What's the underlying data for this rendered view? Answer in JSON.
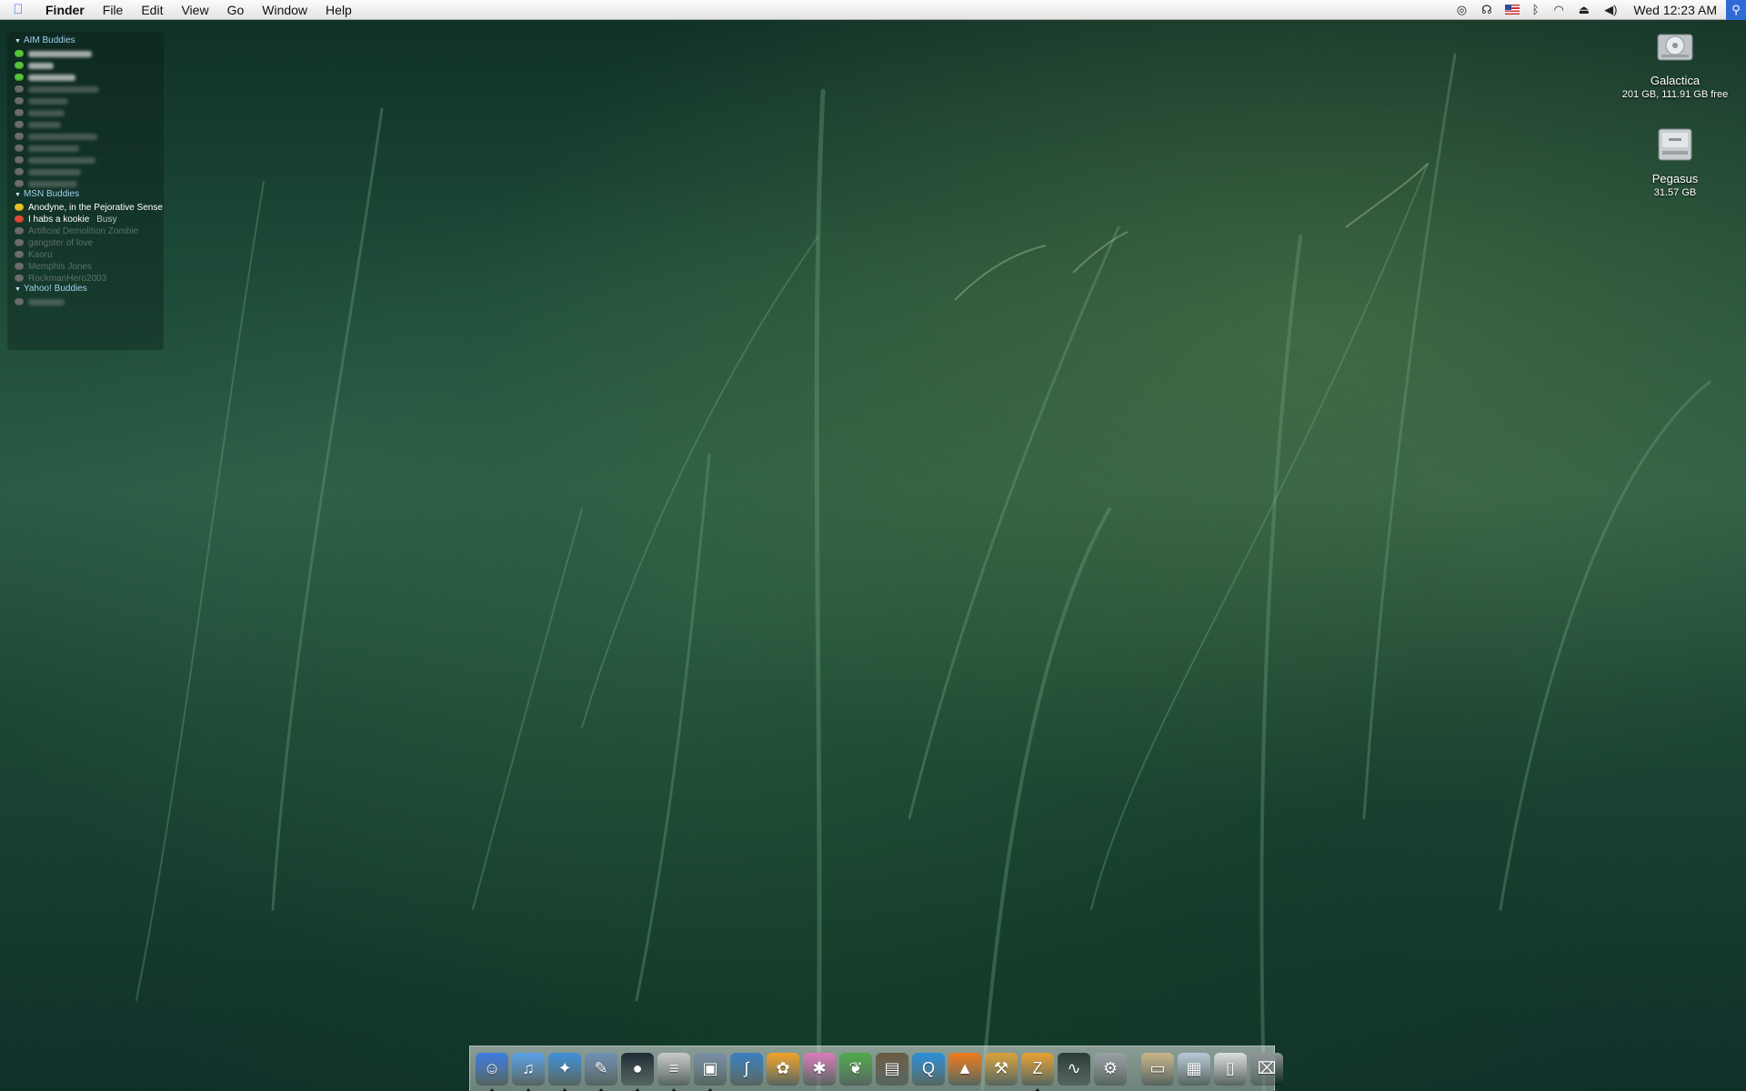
{
  "menubar": {
    "app_name": "Finder",
    "menus": [
      "File",
      "Edit",
      "View",
      "Go",
      "Window",
      "Help"
    ],
    "clock": "Wed 12:23 AM"
  },
  "buddy_list": {
    "groups": [
      {
        "name": "AIM Buddies"
      },
      {
        "name": "MSN Buddies"
      },
      {
        "name": "Yahoo! Buddies"
      }
    ],
    "msn_buddies": [
      {
        "name": "Anodyne, in the Pejorative Sense",
        "state": "available"
      },
      {
        "name": "I habs a kookie",
        "state": "busy",
        "status": "Busy"
      },
      {
        "name": "Artificial Demolition Zombie",
        "state": "offline"
      },
      {
        "name": "gangster of love",
        "state": "offline"
      },
      {
        "name": "Kaoru",
        "state": "offline"
      },
      {
        "name": "Memphis Jones",
        "state": "offline"
      },
      {
        "name": "RockmanHero2003",
        "state": "offline"
      }
    ]
  },
  "desktop_icons": [
    {
      "name": "Galactica",
      "info": "201 GB, 111.91 GB free"
    },
    {
      "name": "Pegasus",
      "info": "31.57 GB"
    }
  ],
  "colors": {
    "accent_blue": "#2f6bd6",
    "status_available": "#55c43a",
    "status_away": "#e8c02a",
    "status_busy": "#e04a3a"
  },
  "dock": {
    "apps": [
      {
        "icon": "finder-icon",
        "color": "#3b7be0",
        "glyph": "☺"
      },
      {
        "icon": "itunes-icon",
        "color": "#5aa0e8",
        "glyph": "♫"
      },
      {
        "icon": "safari-icon",
        "color": "#3d8fd8",
        "glyph": "✦"
      },
      {
        "icon": "preview-icon",
        "color": "#6f8fb3",
        "glyph": "✎"
      },
      {
        "icon": "chat-icon",
        "color": "#1f2a36",
        "glyph": "●"
      },
      {
        "icon": "textedit-icon",
        "color": "#c9c9c9",
        "glyph": "≡"
      },
      {
        "icon": "image-capture-icon",
        "color": "#7a8fa8",
        "glyph": "▣"
      },
      {
        "icon": "feather-icon",
        "color": "#3a7fc0",
        "glyph": "∫"
      },
      {
        "icon": "flower-icon",
        "color": "#f2a22a",
        "glyph": "✿"
      },
      {
        "icon": "pinwheel-icon",
        "color": "#d97ab8",
        "glyph": "✱"
      },
      {
        "icon": "leaf-icon",
        "color": "#4ea84a",
        "glyph": "❦"
      },
      {
        "icon": "photo-icon",
        "color": "#6a5a44",
        "glyph": "▤"
      },
      {
        "icon": "quicktime-icon",
        "color": "#2a8fd8",
        "glyph": "Q"
      },
      {
        "icon": "vlc-icon",
        "color": "#f07a1a",
        "glyph": "▲"
      },
      {
        "icon": "toolbox-icon",
        "color": "#d9a13a",
        "glyph": "⚒"
      },
      {
        "icon": "z-icon",
        "color": "#e8a030",
        "glyph": "Z"
      },
      {
        "icon": "activity-monitor-icon",
        "color": "#2a3a34",
        "glyph": "∿"
      },
      {
        "icon": "system-prefs-icon",
        "color": "#9aa0a6",
        "glyph": "⚙"
      }
    ],
    "docs": [
      {
        "icon": "folder-icon",
        "color": "#c9b488",
        "glyph": "▭"
      },
      {
        "icon": "stack-icon",
        "color": "#b8c8d8",
        "glyph": "▦"
      },
      {
        "icon": "document-icon",
        "color": "#dcdcdc",
        "glyph": "▯"
      },
      {
        "icon": "trash-icon",
        "color": "#8f9698",
        "glyph": "⌧"
      }
    ]
  }
}
